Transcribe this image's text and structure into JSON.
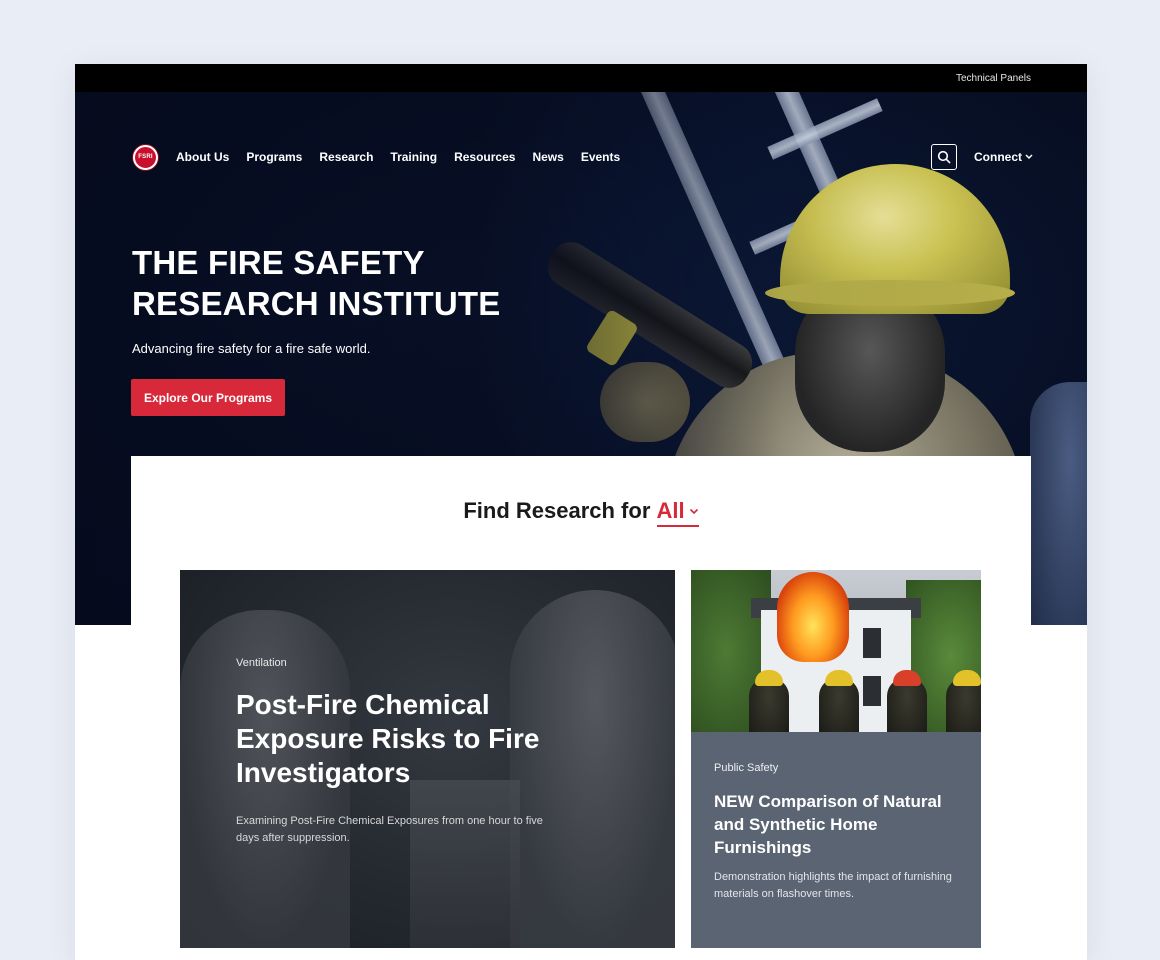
{
  "topbar": {
    "link": "Technical Panels"
  },
  "logo": {
    "text": "FSRI"
  },
  "nav": {
    "items": [
      "About Us",
      "Programs",
      "Research",
      "Training",
      "Resources",
      "News",
      "Events"
    ],
    "connect_label": "Connect",
    "search_icon": "search-icon"
  },
  "hero": {
    "title": "THE FIRE SAFETY RESEARCH INSTITUTE",
    "subtitle": "Advancing fire safety for a fire safe world.",
    "cta_label": "Explore Our Programs"
  },
  "find": {
    "prefix": "Find Research for",
    "selected": "All"
  },
  "cards": [
    {
      "category": "Ventilation",
      "title": "Post-Fire Chemical Exposure Risks to Fire Investigators",
      "description": "Examining Post-Fire Chemical Exposures from one hour to five days after suppression."
    },
    {
      "category": "Public Safety",
      "title": "NEW Comparison of Natural and Synthetic Home Furnishings",
      "description": "Demonstration highlights the impact of furnishing materials on flashover times."
    }
  ],
  "colors": {
    "accent": "#d8293a",
    "topbar": "#000000",
    "card_secondary": "#5a6472",
    "page_bg": "#e9edf5"
  }
}
